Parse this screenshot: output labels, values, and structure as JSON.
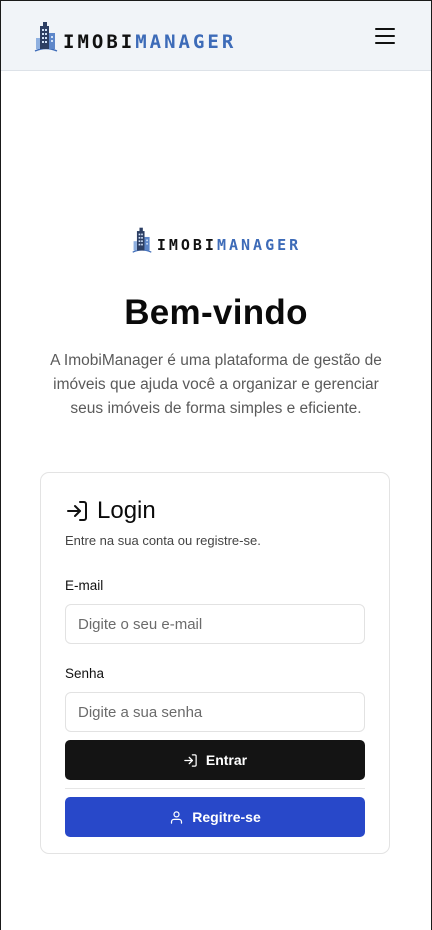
{
  "header": {
    "logo_part1": "IMOBI",
    "logo_part2": "MANAGER"
  },
  "hero": {
    "logo_part1": "IMOBI",
    "logo_part2": "MANAGER",
    "title": "Bem-vindo",
    "description": "A ImobiManager é uma plataforma de gestão de imóveis que ajuda você a organizar e gerenciar seus imóveis de forma simples e eficiente."
  },
  "login": {
    "title": "Login",
    "subtitle": "Entre na sua conta ou registre-se.",
    "email_label": "E-mail",
    "email_placeholder": "Digite o seu e-mail",
    "password_label": "Senha",
    "password_placeholder": "Digite a sua senha",
    "submit_label": "Entrar",
    "register_label": "Regitre-se"
  },
  "colors": {
    "brand_blue": "#3d6bb8",
    "primary_button": "#141414",
    "register_button": "#2848c9",
    "header_bg": "#f1f4f8"
  },
  "icons": {
    "logo": "building-icon",
    "menu": "hamburger-menu-icon",
    "login": "log-in-icon",
    "user": "user-icon"
  }
}
